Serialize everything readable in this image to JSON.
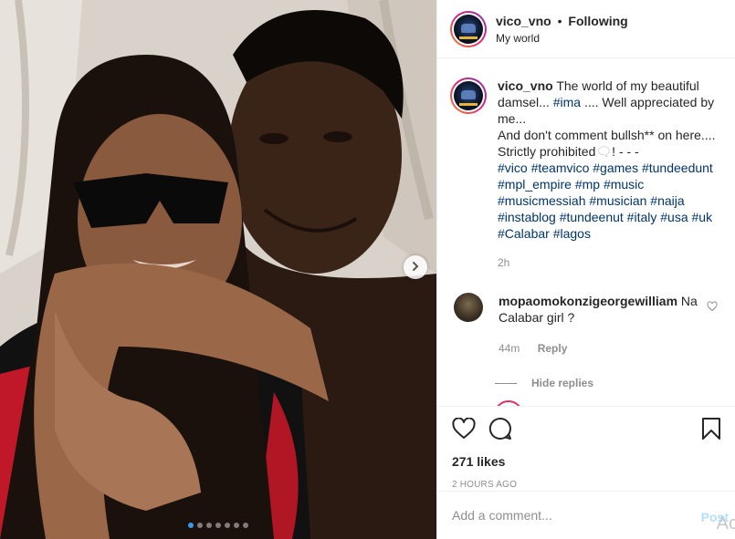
{
  "header": {
    "username": "vico_vno",
    "separator": "•",
    "follow_status": "Following",
    "subtitle": "My world"
  },
  "caption": {
    "username": "vico_vno",
    "text_part1": "The world of my beautiful damsel...",
    "mention": "#ima",
    "text_part2": ".... Well appreciated by me...",
    "text_part3": "And don't comment bullsh** on here.... Strictly prohibited",
    "text_part4": "! - - -",
    "hashtags": "#vico #teamvico #games #tundeedunt #mpl_empire #mp #music #musicmessiah #musician #naija #instablog #tundeenut #italy #usa #uk #Calabar #lagos",
    "time": "2h"
  },
  "comment": {
    "username": "mopaomokonzigeorgewilliam",
    "text": "Na Calabar girl ?",
    "time": "44m",
    "reply_label": "Reply",
    "hide_replies_label": "Hide replies"
  },
  "actions": {
    "likes": "271 likes",
    "posted_ago": "2 HOURS AGO"
  },
  "add_comment": {
    "placeholder": "Add a comment...",
    "post_label": "Post",
    "watermark": "Ac"
  },
  "carousel": {
    "slide_count": 7,
    "active_index": 0
  },
  "colors": {
    "link": "#003569",
    "meta": "#8e8e8e",
    "post_disabled": "#b2dffc",
    "story_ring": "#dd2a7b"
  }
}
